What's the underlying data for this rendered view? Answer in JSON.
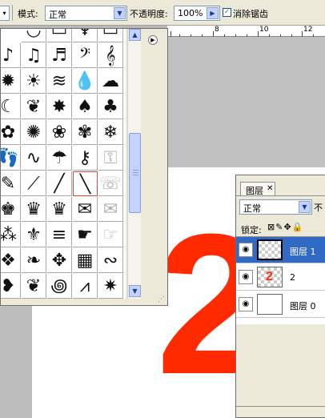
{
  "options_bar": {
    "mode_label": "模式:",
    "mode_value": "正常",
    "opacity_label": "不透明度:",
    "opacity_value": "100%",
    "antialias_label": "消除锯齿",
    "antialias_checked": true
  },
  "ruler": {
    "numbers": [
      "8",
      "10",
      "12"
    ]
  },
  "canvas": {
    "big_text": "2",
    "big_text_color": "#ff2a00"
  },
  "shape_picker": {
    "rows": [
      [
        "arc-shape",
        "frame-shape",
        "ornament-shape",
        "banner-shape"
      ],
      [
        "eighth-note-icon",
        "beamed-notes-icon",
        "sixteenth-note-icon",
        "bass-clef-icon",
        "treble-clef-icon"
      ],
      [
        "sun-icon",
        "sunburst-icon",
        "waves-icon",
        "raindrop-icon",
        "cloud-icon"
      ],
      [
        "crescent-moon-icon",
        "leaf-icon",
        "maple-leaf-icon",
        "leaf-shape-icon",
        "oak-leaf-icon"
      ],
      [
        "flower-icon",
        "daisy-icon",
        "flower-round-icon",
        "flower-petals-icon",
        "snowflake-icon"
      ],
      [
        "footprint-icon",
        "bare-foot-icon",
        "umbrella-icon",
        "key-icon",
        "key-outline-icon"
      ],
      [
        "pencil-icon",
        "brush-icon",
        "needle-icon",
        "knife-icon",
        "telephone-icon"
      ],
      [
        "king-icon",
        "crown-icon",
        "queen-icon",
        "envelope-icon",
        "envelope-outline-icon"
      ],
      [
        "splat-icon",
        "fleur-icon",
        "flag-icon",
        "pointing-hand-icon",
        "pointing-hand-outline-icon"
      ],
      [
        "knot-icon",
        "ornament-icon",
        "tile-icon",
        "texture-icon",
        "scroll-ornament-icon"
      ],
      [
        "heart-dots-icon",
        "ornament-curl-icon",
        "spiral-icon",
        "zigzag-icon",
        "starburst-icon"
      ]
    ],
    "selected_shape": "knife-icon",
    "glyphs": {
      "arc-shape": "◡",
      "frame-shape": "▭",
      "ornament-shape": "♆",
      "banner-shape": "▭",
      "eighth-note-icon": "♪",
      "beamed-notes-icon": "♫",
      "sixteenth-note-icon": "♬",
      "bass-clef-icon": "𝄢",
      "treble-clef-icon": "𝄞",
      "sun-icon": "✹",
      "sunburst-icon": "☀",
      "waves-icon": "≋",
      "raindrop-icon": "💧",
      "cloud-icon": "☁",
      "crescent-moon-icon": "☾",
      "leaf-icon": "❦",
      "maple-leaf-icon": "✸",
      "leaf-shape-icon": "♠",
      "oak-leaf-icon": "♣",
      "flower-icon": "✿",
      "daisy-icon": "✺",
      "flower-round-icon": "❀",
      "flower-petals-icon": "✾",
      "snowflake-icon": "❄",
      "footprint-icon": "👣",
      "bare-foot-icon": "∿",
      "umbrella-icon": "☂",
      "key-icon": "⚷",
      "key-outline-icon": "⚿",
      "pencil-icon": "✎",
      "brush-icon": "⟋",
      "needle-icon": "╱",
      "knife-icon": "╲",
      "telephone-icon": "☏",
      "king-icon": "♚",
      "crown-icon": "♛",
      "queen-icon": "♛",
      "envelope-icon": "✉",
      "envelope-outline-icon": "✉",
      "splat-icon": "⁂",
      "fleur-icon": "⚜",
      "flag-icon": "≡",
      "pointing-hand-icon": "☛",
      "pointing-hand-outline-icon": "☞",
      "knot-icon": "❖",
      "ornament-icon": "❧",
      "tile-icon": "✥",
      "texture-icon": "▦",
      "scroll-ornament-icon": "∾",
      "heart-dots-icon": "❥",
      "ornament-curl-icon": "❦",
      "spiral-icon": "꩜",
      "zigzag-icon": "⩘",
      "starburst-icon": "✷"
    }
  },
  "layers_panel": {
    "tab_label": "图层",
    "blend_mode": "正常",
    "opacity_label": "不",
    "lock_label": "锁定:",
    "layers": [
      {
        "name": "图层 1",
        "active": true,
        "thumb": "transparent"
      },
      {
        "name": "2",
        "active": false,
        "thumb": "two"
      },
      {
        "name": "图层 0",
        "active": false,
        "thumb": "white"
      }
    ]
  }
}
